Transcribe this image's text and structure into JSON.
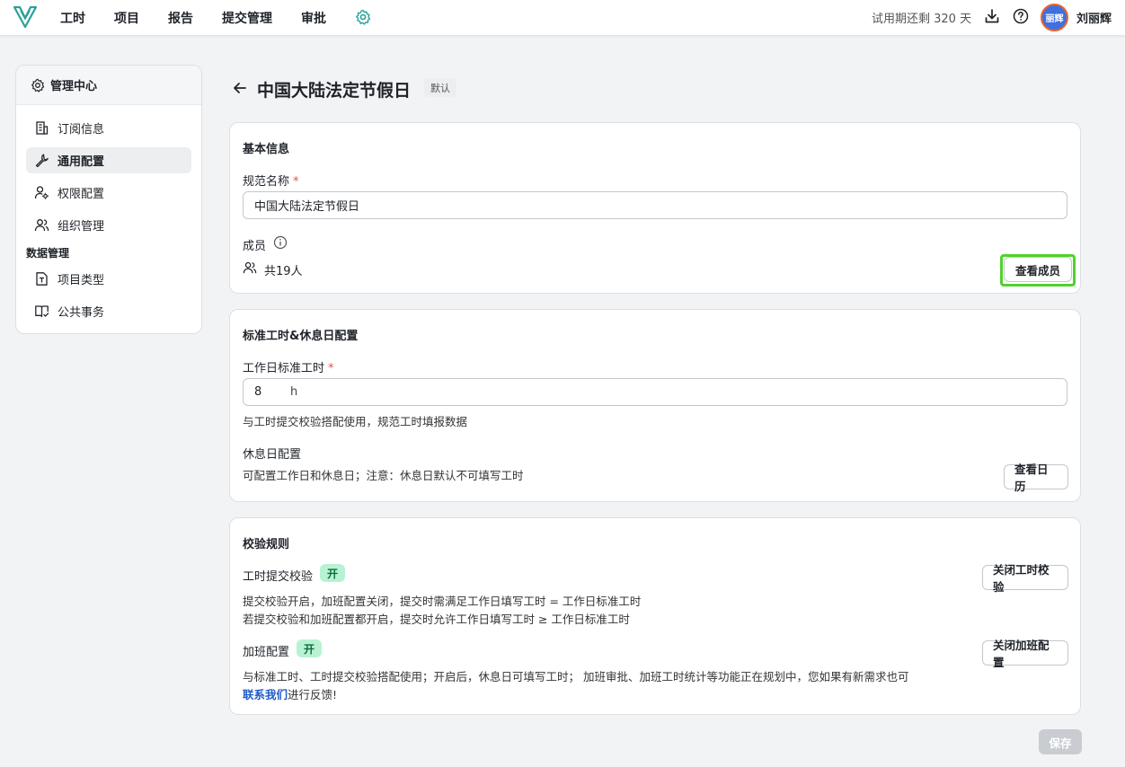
{
  "nav": {
    "items": [
      "工时",
      "项目",
      "报告",
      "提交管理",
      "审批"
    ],
    "trial_text": "试用期还剩 320 天",
    "avatar_text": "丽辉",
    "username": "刘丽辉",
    "icons": [
      "logo-icon",
      "gear-icon",
      "download-icon",
      "help-icon"
    ]
  },
  "sidebar": {
    "title": "管理中心",
    "items": [
      {
        "label": "订阅信息",
        "icon": "building-icon"
      },
      {
        "label": "通用配置",
        "icon": "wrench-icon",
        "active": true
      },
      {
        "label": "权限配置",
        "icon": "user-permission-icon"
      },
      {
        "label": "组织管理",
        "icon": "users-icon"
      }
    ],
    "group_label": "数据管理",
    "group_items": [
      {
        "label": "项目类型",
        "icon": "document-icon"
      },
      {
        "label": "公共事务",
        "icon": "book-icon"
      }
    ]
  },
  "page": {
    "title": "中国大陆法定节假日",
    "tag": "默认"
  },
  "basic": {
    "section_title": "基本信息",
    "name_label": "规范名称",
    "required_mark": "*",
    "name_value": "中国大陆法定节假日",
    "members_label": "成员",
    "members_count": "共19人",
    "view_members": "查看成员"
  },
  "hours": {
    "section_title": "标准工时&休息日配置",
    "std_label": "工作日标准工时",
    "required_mark": "*",
    "std_value": "8",
    "std_unit": "h",
    "std_hint": "与工时提交校验搭配使用，规范工时填报数据",
    "rest_label": "休息日配置",
    "rest_hint": "可配置工作日和休息日；注意：休息日默认不可填写工时",
    "view_calendar": "查看日历"
  },
  "rules": {
    "section_title": "校验规则",
    "submit_label": "工时提交校验",
    "submit_status": "开",
    "submit_hint_1": "提交校验开启，加班配置关闭，提交时需满足工作日填写工时 = 工作日标准工时",
    "submit_hint_2": "若提交校验和加班配置都开启，提交时允许工作日填写工时 ≥ 工作日标准工时",
    "close_submit": "关闭工时校验",
    "overtime_label": "加班配置",
    "overtime_status": "开",
    "overtime_hint": "与标准工时、工时提交校验搭配使用；开启后，休息日可填写工时； 加班审批、加班工时统计等功能正在规划中，您如果有新需求也可",
    "contact_link": "联系我们",
    "feedback_text": "进行反馈!",
    "close_overtime": "关闭加班配置"
  },
  "footer": {
    "save": "保存"
  },
  "colors": {
    "accent_green": "#52d12e",
    "badge_bg": "#b7f2d4",
    "link": "#1f5bc9",
    "logo_teal": "#2aa198"
  }
}
